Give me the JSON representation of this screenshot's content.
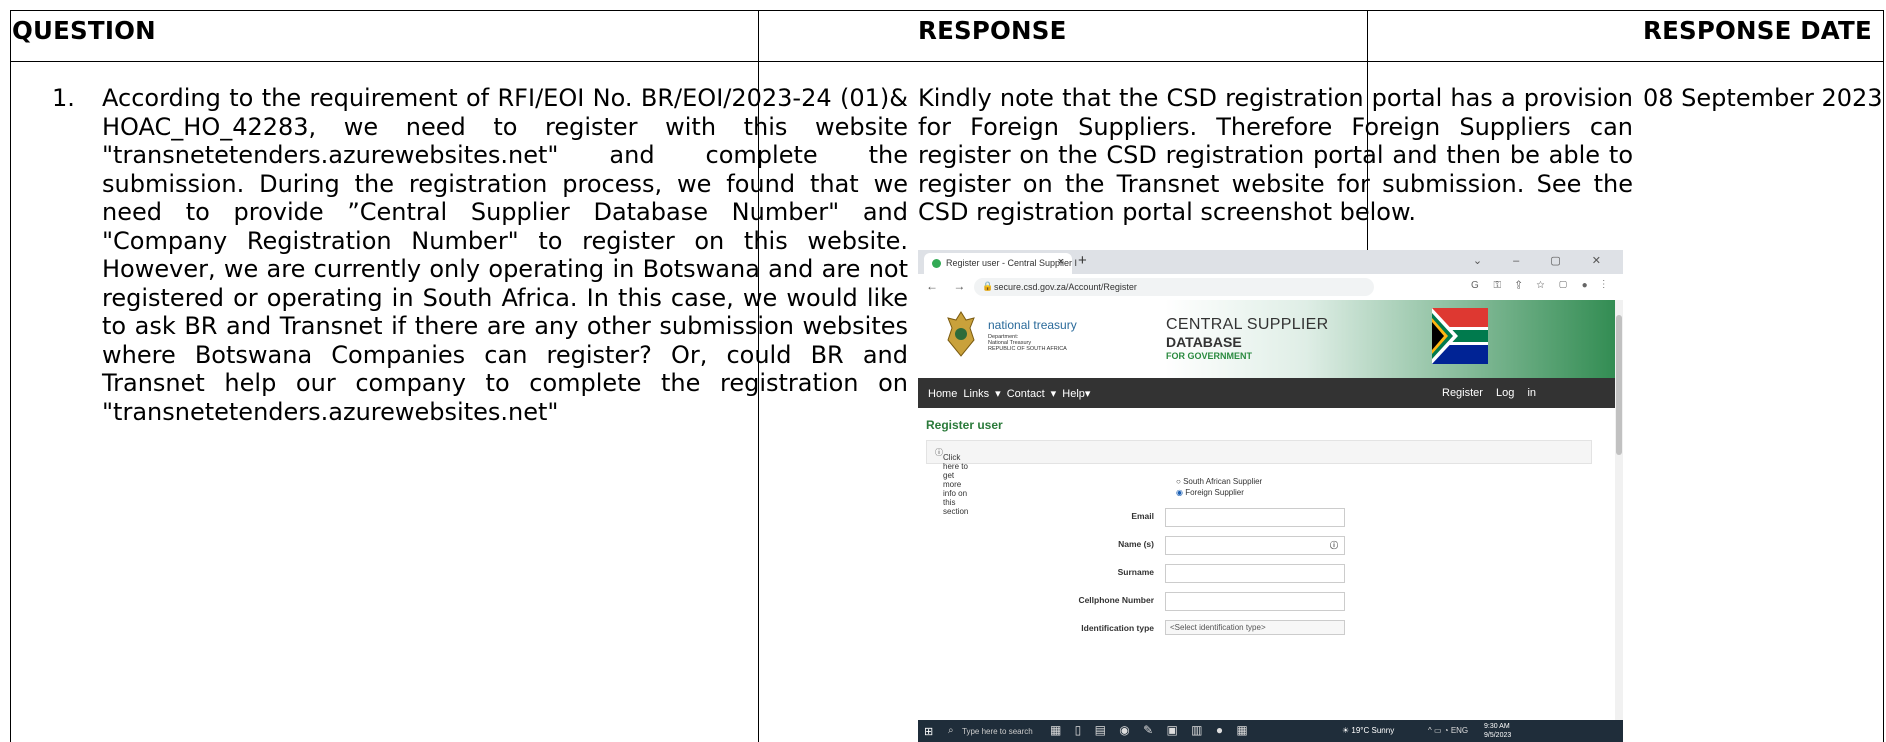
{
  "headers": {
    "question": "QUESTION",
    "response": "RESPONSE",
    "response_date": "RESPONSE DATE"
  },
  "row": {
    "number": "1.",
    "question": "According to the requirement of RFI/EOI No. BR/EOI/2023-24 (01)& HOAC_HO_42283, we need to register with this website \"transnetetenders.azurewebsites.net\" and complete the submission. During the registration process, we found that we need to provide ”Central Supplier Database Number\" and \"Company Registration Number\" to register on this website. However, we are currently only operating in Botswana and are not registered or operating in South Africa. In this case, we would like to ask BR and Transnet if there are any other submission websites where Botswana Companies can register? Or, could BR and Transnet help our company to complete the registration on \"transnetetenders.azurewebsites.net\"",
    "response": "Kindly note that the CSD registration portal has a provision for Foreign Suppliers. Therefore Foreign Suppliers can register on the CSD registration portal and then be able to register on the Transnet website for submission. See the CSD registration portal screenshot below.",
    "date": "08 September 2023"
  },
  "screenshot": {
    "tab_title": "Register user - Central Supplier I",
    "url": "secure.csd.gov.za/Account/Register",
    "logo_title": "national treasury",
    "logo_sub1": "Department:",
    "logo_sub2": "National Treasury",
    "logo_sub3": "REPUBLIC OF SOUTH AFRICA",
    "banner_line1": "CENTRAL SUPPLIER",
    "banner_line2": "DATABASE",
    "banner_line3": "FOR GOVERNMENT",
    "nav_left": "Home  Links ▾  Contact ▾  Help▾",
    "nav_register": "Register",
    "nav_login": "Log in",
    "page_title": "Register user",
    "info_text": "Click here to get more info on this section",
    "radio_sa": "South African Supplier",
    "radio_foreign": "Foreign Supplier",
    "fields": {
      "email": "Email",
      "name": "Name (s)",
      "surname": "Surname",
      "cellphone": "Cellphone Number",
      "id_type": "Identification type"
    },
    "id_type_placeholder": "<Select identification type>",
    "taskbar_search": "Type here to search",
    "weather": "19°C  Sunny",
    "time": "9:30 AM",
    "date": "9/5/2023",
    "lang": "ENG",
    "colors": {
      "brand_green": "#2a7a3a",
      "nav_dark": "#333333",
      "taskbar": "#1f2d3a"
    }
  }
}
